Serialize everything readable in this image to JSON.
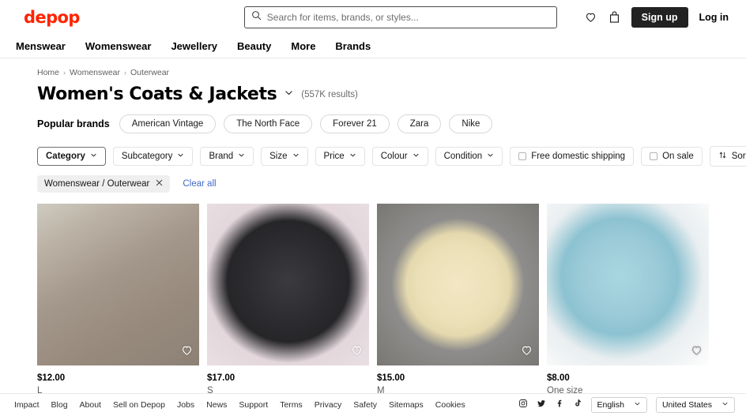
{
  "header": {
    "logo_text": "depop",
    "search": {
      "placeholder": "Search for items, brands, or styles...",
      "value": "",
      "icon": "search-icon"
    },
    "wishlist_icon": "heart-icon",
    "bag_icon": "shopping-bag-icon",
    "signup_label": "Sign up",
    "login_label": "Log in"
  },
  "nav": {
    "items": [
      {
        "label": "Menswear"
      },
      {
        "label": "Womenswear"
      },
      {
        "label": "Jewellery"
      },
      {
        "label": "Beauty"
      },
      {
        "label": "More"
      },
      {
        "label": "Brands"
      }
    ]
  },
  "breadcrumb": {
    "items": [
      {
        "label": "Home"
      },
      {
        "label": "Womenswear"
      },
      {
        "label": "Outerwear"
      }
    ],
    "separator": "›"
  },
  "page": {
    "title": "Women's Coats & Jackets",
    "title_chevron_icon": "chevron-down-icon",
    "results": "(557K results)"
  },
  "popular_brands": {
    "label": "Popular brands",
    "chips": [
      {
        "label": "American Vintage"
      },
      {
        "label": "The North Face"
      },
      {
        "label": "Forever 21"
      },
      {
        "label": "Zara"
      },
      {
        "label": "Nike"
      }
    ]
  },
  "filters": {
    "dropdowns": [
      {
        "label": "Category",
        "active": true
      },
      {
        "label": "Subcategory",
        "active": false
      },
      {
        "label": "Brand",
        "active": false
      },
      {
        "label": "Size",
        "active": false
      },
      {
        "label": "Price",
        "active": false
      },
      {
        "label": "Colour",
        "active": false
      },
      {
        "label": "Condition",
        "active": false
      }
    ],
    "checkboxes": [
      {
        "label": "Free domestic shipping",
        "checked": false
      },
      {
        "label": "On sale",
        "checked": false
      }
    ],
    "sort_label": "Sort",
    "sort_icon": "sort-arrows-icon",
    "chevron_icon": "chevron-down-icon"
  },
  "active_filters": {
    "chips": [
      {
        "label": "Womenswear / Outerwear",
        "remove_icon": "close-icon"
      }
    ],
    "clear_all_label": "Clear all"
  },
  "products": [
    {
      "price": "$12.00",
      "size": "L",
      "alt": "brown-hoodie",
      "heart_icon": "heart-icon",
      "bg": "linear-gradient(150deg,#cfcbc0 0%,#bcb3a6 18%,#a3968a 45%,#978a7d 72%,#8d8176 100%)"
    },
    {
      "price": "$17.00",
      "size": "S",
      "alt": "black-studded-hoodie",
      "heart_icon": "heart-icon",
      "bg": "radial-gradient(circle at 50% 48%,#3a3a3f 0%,#2b2b2f 38%,#262629 52%,#e3d7dc 70%,#e9dfe3 100%)"
    },
    {
      "price": "$15.00",
      "size": "M",
      "alt": "cream-blazer",
      "heart_icon": "heart-icon",
      "bg": "radial-gradient(ellipse at 50% 50%,#f2e7c4 0%,#ece0b8 34%,#e4d8ae 45%,#8e8d8b 58%,#787774 100%)"
    },
    {
      "price": "$8.00",
      "size": "One size",
      "alt": "blue-knit-shawl",
      "heart_icon": "heart-icon",
      "bg": "radial-gradient(ellipse at 45% 45%,#a9d6e0 0%,#9ccbd8 30%,#8cc2d1 46%,#e9eef0 66%,#fdfdfd 100%)"
    }
  ],
  "next_row_strips": [
    {
      "bg": "linear-gradient(90deg,#e8681f 0%,#d9571a 22%,#4a4037 42%,#cfa184 68%,#e0713a 100%)"
    },
    {
      "bg": "linear-gradient(90deg,#c9c6c4 0%,#9e9a99 25%,#46423f 52%,#c3bfbd 78%,#d9d6d4 100%)"
    },
    {
      "bg": "linear-gradient(90deg,#e6cfc6 0%,#dfc2b6 35%,#d9b8ab 65%,#e8d6cd 100%)"
    },
    {
      "bg": "linear-gradient(90deg,#8f8b87 0%,#6a6662 28%,#3a3734 55%,#7b7773 82%,#a5a19d 100%)"
    }
  ],
  "footer": {
    "links": [
      {
        "label": "Impact"
      },
      {
        "label": "Blog"
      },
      {
        "label": "About"
      },
      {
        "label": "Sell on Depop"
      },
      {
        "label": "Jobs"
      },
      {
        "label": "News"
      },
      {
        "label": "Support"
      },
      {
        "label": "Terms"
      },
      {
        "label": "Privacy"
      },
      {
        "label": "Safety"
      },
      {
        "label": "Sitemaps"
      },
      {
        "label": "Cookies"
      }
    ],
    "socials": [
      {
        "name": "instagram-icon"
      },
      {
        "name": "twitter-icon"
      },
      {
        "name": "facebook-icon"
      },
      {
        "name": "tiktok-icon"
      }
    ],
    "language": {
      "value": "English",
      "chevron_icon": "chevron-down-icon"
    },
    "country": {
      "value": "United States",
      "chevron_icon": "chevron-down-icon"
    }
  },
  "colors": {
    "brand_red": "#ff2300",
    "signup_bg": "#222222",
    "link_blue": "#4169c9",
    "chip_bg": "#efefef"
  }
}
